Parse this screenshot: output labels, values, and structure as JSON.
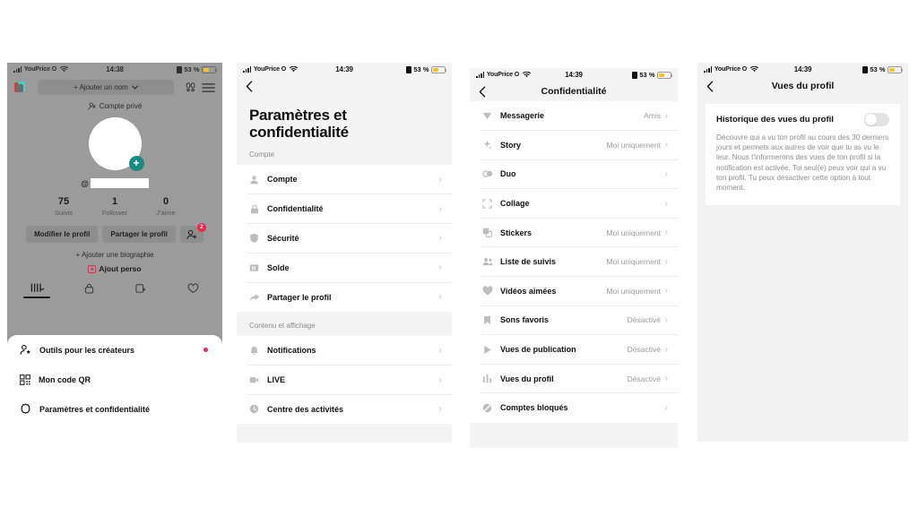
{
  "status_bar": {
    "carrier": "YouPrice O",
    "time_profile": "14:38",
    "time_settings": "14:39",
    "battery_percent": "53 %",
    "battery_level": 53,
    "wifi_icon": "wifi-icon",
    "signal_icon": "cellular-signal-icon",
    "lowpower_icon": "low-power-icon"
  },
  "panel_profile": {
    "name": "profile-screen",
    "logo_icon": "tiktok-logo-icon",
    "add_name_label": "+ Ajouter un nom",
    "add_name_chevron": "chevron-down-icon",
    "footprints_icon": "footprints-icon",
    "menu_icon": "hamburger-menu-icon",
    "private_account_label": "Compte privé",
    "private_account_icon": "private-person-icon",
    "avatar_icon": "avatar",
    "add_avatar_label": "+",
    "handle_prefix": "@",
    "stats": [
      {
        "value": "75",
        "label": "Suivis"
      },
      {
        "value": "1",
        "label": "Follower"
      },
      {
        "value": "0",
        "label": "J'aime"
      }
    ],
    "edit_profile_label": "Modifier le profil",
    "share_profile_label": "Partager le profil",
    "add_friends_icon": "add-friends-icon",
    "add_friends_badge": "2",
    "add_bio_label": "+ Ajouter une biographie",
    "add_perso_label": "Ajout perso",
    "add_perso_icon": "plus-square-icon",
    "tabs": [
      {
        "icon": "grid-posts-icon",
        "active": true
      },
      {
        "icon": "lock-private-icon",
        "active": false
      },
      {
        "icon": "repost-icon",
        "active": false
      },
      {
        "icon": "heart-liked-icon",
        "active": false
      }
    ],
    "sheet_items": [
      {
        "label": "Outils pour les créateurs",
        "icon": "creator-tools-icon",
        "dot": true
      },
      {
        "label": "Mon code QR",
        "icon": "qr-code-icon",
        "dot": false
      },
      {
        "label": "Paramètres et confidentialité",
        "icon": "gear-icon",
        "dot": false
      }
    ]
  },
  "panel_settings": {
    "name": "settings-and-privacy-screen",
    "back_icon": "chevron-left-icon",
    "title": "Paramètres et confidentialité",
    "groups": [
      {
        "label": "Compte",
        "rows": [
          {
            "label": "Compte",
            "icon": "person-icon",
            "chevron": "›"
          },
          {
            "label": "Confidentialité",
            "icon": "lock-icon",
            "chevron": "›"
          },
          {
            "label": "Sécurité",
            "icon": "shield-icon",
            "chevron": "›"
          },
          {
            "label": "Solde",
            "icon": "wallet-icon",
            "chevron": "›"
          },
          {
            "label": "Partager le profil",
            "icon": "share-arrow-icon",
            "chevron": "›"
          }
        ]
      },
      {
        "label": "Contenu et affichage",
        "rows": [
          {
            "label": "Notifications",
            "icon": "bell-icon",
            "chevron": "›"
          },
          {
            "label": "LIVE",
            "icon": "live-video-icon",
            "chevron": "›"
          },
          {
            "label": "Centre des activités",
            "icon": "clock-icon",
            "chevron": "›"
          }
        ]
      }
    ]
  },
  "panel_privacy": {
    "name": "privacy-screen",
    "back_icon": "chevron-left-icon",
    "title": "Confidentialité",
    "rows": [
      {
        "label": "Messagerie",
        "icon": "paper-plane-icon",
        "value": "Amis",
        "chevron": "›"
      },
      {
        "label": "Story",
        "icon": "sparkle-story-icon",
        "value": "Moi uniquement",
        "chevron": "›"
      },
      {
        "label": "Duo",
        "icon": "duo-icon",
        "value": "",
        "chevron": "›"
      },
      {
        "label": "Collage",
        "icon": "stitch-icon",
        "value": "",
        "chevron": "›"
      },
      {
        "label": "Stickers",
        "icon": "stickers-icon",
        "value": "Moi uniquement",
        "chevron": "›"
      },
      {
        "label": "Liste de suivis",
        "icon": "following-list-icon",
        "value": "Moi uniquement",
        "chevron": "›"
      },
      {
        "label": "Vidéos aimées",
        "icon": "heart-icon",
        "value": "Moi uniquement",
        "chevron": "›"
      },
      {
        "label": "Sons favoris",
        "icon": "bookmark-icon",
        "value": "Désactivé",
        "chevron": "›"
      },
      {
        "label": "Vues de publication",
        "icon": "play-icon",
        "value": "Désactivé",
        "chevron": "›"
      },
      {
        "label": "Vues du profil",
        "icon": "profile-views-icon",
        "value": "Désactivé",
        "chevron": "›"
      },
      {
        "label": "Comptes bloqués",
        "icon": "block-icon",
        "value": "",
        "chevron": "›"
      }
    ]
  },
  "panel_profile_views": {
    "name": "profile-views-screen",
    "back_icon": "chevron-left-icon",
    "title": "Vues du profil",
    "setting_label": "Historique des vues du profil",
    "toggle_state": "off",
    "description": "Découvre qui a vu ton profil au cours des 30 derniers jours et permets aux autres de voir que tu as vu le leur. Nous t'informerons des vues de ton profil si la notification est activée. Toi seul(e) peux voir qui a vu ton profil. Tu peux désactiver cette option à tout moment."
  },
  "colors": {
    "accent_red": "#f0264f",
    "teal": "#1a8a84",
    "battery_yellow": "#f5c518",
    "page_bg": "#f4f4f4",
    "card_bg": "#ffffff"
  }
}
